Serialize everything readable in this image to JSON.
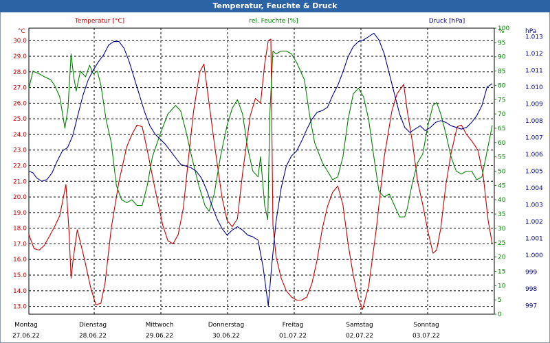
{
  "window": {
    "title": "Temperatur, Feuchte & Druck"
  },
  "colors": {
    "temperature": "#c00000",
    "humidity": "#008000",
    "pressure": "#00008b",
    "title_bg": "#2c63a5",
    "grid": "#000000"
  },
  "chart_data": {
    "type": "line",
    "title": "Temperatur, Feuchte & Druck",
    "grid": true,
    "axes": {
      "left": {
        "label": "Temperatur [°C]",
        "unit": "°C",
        "ylim": [
          12.5,
          30.8
        ],
        "ticks": [
          "13.0",
          "14.0",
          "15.0",
          "16.0",
          "17.0",
          "18.0",
          "19.0",
          "20.0",
          "21.0",
          "22.0",
          "23.0",
          "24.0",
          "25.0",
          "26.0",
          "27.0",
          "28.0",
          "29.0",
          "30.0"
        ]
      },
      "mid": {
        "label": "rel. Feuchte [%]",
        "unit": "%",
        "ylim": [
          0,
          100
        ],
        "ticks": [
          "0",
          "5",
          "10",
          "15",
          "20",
          "25",
          "30",
          "35",
          "40",
          "45",
          "50",
          "55",
          "60",
          "65",
          "70",
          "75",
          "80",
          "85",
          "90",
          "95",
          "100"
        ]
      },
      "right": {
        "label": "Druck [hPa]",
        "unit": "hPa",
        "ylim": [
          996.5,
          1013.5
        ],
        "ticks": [
          "997",
          "998",
          "999",
          "1.000",
          "1.001",
          "1.002",
          "1.003",
          "1.004",
          "1.005",
          "1.006",
          "1.007",
          "1.008",
          "1.009",
          "1.010",
          "1.011",
          "1.012",
          "1.013"
        ]
      }
    },
    "x_range": [
      0,
      7
    ],
    "days": [
      {
        "name": "Montag",
        "date": "27.06.22"
      },
      {
        "name": "Dienstag",
        "date": "28.06.22"
      },
      {
        "name": "Mittwoch",
        "date": "29.06.22"
      },
      {
        "name": "Donnerstag",
        "date": "30.06.22"
      },
      {
        "name": "Freitag",
        "date": "01.07.22"
      },
      {
        "name": "Samstag",
        "date": "02.07.22"
      },
      {
        "name": "Sonntag",
        "date": "03.07.22"
      }
    ],
    "series": [
      {
        "name": "Temperatur [°C]",
        "axis": "left",
        "color": "#c00000",
        "points": [
          [
            0,
            17.6
          ],
          [
            0.1,
            16.7
          ],
          [
            0.2,
            16.6
          ],
          [
            0.3,
            16.9
          ],
          [
            0.4,
            17.5
          ],
          [
            0.5,
            18.1
          ],
          [
            0.6,
            18.8
          ],
          [
            0.72,
            20.8
          ],
          [
            0.78,
            17.8
          ],
          [
            0.82,
            14.8
          ],
          [
            0.86,
            16.0
          ],
          [
            0.94,
            17.9
          ],
          [
            1.0,
            17.1
          ],
          [
            1.08,
            16.0
          ],
          [
            1.2,
            14.2
          ],
          [
            1.3,
            13.1
          ],
          [
            1.4,
            13.2
          ],
          [
            1.48,
            14.5
          ],
          [
            1.6,
            18.0
          ],
          [
            1.75,
            21.0
          ],
          [
            1.9,
            23.2
          ],
          [
            2.0,
            24.0
          ],
          [
            2.1,
            24.6
          ],
          [
            2.2,
            24.5
          ],
          [
            2.3,
            23.0
          ],
          [
            2.45,
            20.5
          ],
          [
            2.6,
            18.2
          ],
          [
            2.7,
            17.2
          ],
          [
            2.8,
            17.0
          ],
          [
            2.9,
            17.6
          ],
          [
            3.0,
            19.3
          ],
          [
            3.1,
            22.5
          ],
          [
            3.2,
            25.5
          ],
          [
            3.32,
            28.0
          ],
          [
            3.4,
            28.5
          ],
          [
            3.5,
            26.0
          ],
          [
            3.62,
            23.0
          ],
          [
            3.75,
            20.0
          ],
          [
            3.85,
            18.5
          ],
          [
            3.95,
            18.1
          ],
          [
            4.05,
            18.6
          ],
          [
            4.15,
            21.5
          ],
          [
            4.3,
            25.2
          ],
          [
            4.4,
            26.3
          ],
          [
            4.5,
            26.0
          ],
          [
            4.58,
            28.5
          ],
          [
            4.65,
            30.0
          ],
          [
            4.7,
            30.1
          ],
          [
            4.74,
            18.2
          ],
          [
            4.8,
            16.2
          ],
          [
            4.9,
            14.8
          ],
          [
            5.0,
            14.0
          ],
          [
            5.1,
            13.6
          ],
          [
            5.2,
            13.4
          ],
          [
            5.3,
            13.4
          ],
          [
            5.4,
            13.6
          ],
          [
            5.5,
            14.5
          ],
          [
            5.6,
            16.0
          ],
          [
            5.7,
            18.0
          ],
          [
            5.8,
            19.4
          ],
          [
            5.9,
            20.3
          ],
          [
            6.0,
            20.7
          ],
          [
            6.1,
            19.5
          ],
          [
            6.2,
            17.0
          ],
          [
            6.3,
            15.0
          ],
          [
            6.4,
            13.5
          ],
          [
            6.48,
            12.8
          ],
          [
            6.6,
            14.3
          ],
          [
            6.75,
            18.0
          ],
          [
            6.9,
            22.5
          ],
          [
            7.05,
            25.5
          ],
          [
            7.15,
            26.6
          ],
          [
            7.28,
            27.2
          ],
          [
            7.35,
            25.5
          ],
          [
            7.45,
            23.5
          ],
          [
            7.55,
            21.0
          ],
          [
            7.65,
            19.5
          ],
          [
            7.75,
            17.8
          ],
          [
            7.85,
            16.4
          ],
          [
            7.92,
            16.6
          ],
          [
            8.0,
            18.0
          ],
          [
            8.1,
            20.8
          ],
          [
            8.2,
            22.8
          ],
          [
            8.32,
            24.5
          ],
          [
            8.4,
            24.6
          ],
          [
            8.5,
            24.0
          ],
          [
            8.62,
            23.5
          ],
          [
            8.72,
            23.0
          ],
          [
            8.82,
            21.5
          ],
          [
            8.92,
            18.5
          ],
          [
            9.0,
            17.0
          ]
        ]
      },
      {
        "name": "rel. Feuchte [%]",
        "axis": "mid",
        "color": "#008000",
        "points": [
          [
            0,
            79
          ],
          [
            0.08,
            85
          ],
          [
            0.2,
            84
          ],
          [
            0.3,
            83
          ],
          [
            0.42,
            82
          ],
          [
            0.5,
            80
          ],
          [
            0.6,
            76
          ],
          [
            0.7,
            65
          ],
          [
            0.76,
            72
          ],
          [
            0.82,
            91
          ],
          [
            0.87,
            83
          ],
          [
            0.92,
            78
          ],
          [
            1.0,
            85
          ],
          [
            1.1,
            83
          ],
          [
            1.18,
            87
          ],
          [
            1.25,
            84
          ],
          [
            1.33,
            85
          ],
          [
            1.4,
            80
          ],
          [
            1.5,
            68
          ],
          [
            1.6,
            60
          ],
          [
            1.7,
            45
          ],
          [
            1.8,
            40
          ],
          [
            1.9,
            39
          ],
          [
            2.0,
            40
          ],
          [
            2.1,
            38
          ],
          [
            2.2,
            38
          ],
          [
            2.3,
            45
          ],
          [
            2.4,
            55
          ],
          [
            2.55,
            63
          ],
          [
            2.7,
            70
          ],
          [
            2.85,
            73
          ],
          [
            2.95,
            71
          ],
          [
            3.05,
            64
          ],
          [
            3.15,
            56
          ],
          [
            3.3,
            45
          ],
          [
            3.42,
            38
          ],
          [
            3.5,
            36
          ],
          [
            3.6,
            42
          ],
          [
            3.72,
            55
          ],
          [
            3.85,
            66
          ],
          [
            3.95,
            72
          ],
          [
            4.05,
            75
          ],
          [
            4.15,
            70
          ],
          [
            4.25,
            58
          ],
          [
            4.35,
            50
          ],
          [
            4.45,
            48
          ],
          [
            4.5,
            55
          ],
          [
            4.58,
            38
          ],
          [
            4.64,
            33
          ],
          [
            4.68,
            70
          ],
          [
            4.74,
            92
          ],
          [
            4.8,
            91
          ],
          [
            4.9,
            92
          ],
          [
            5.0,
            92
          ],
          [
            5.1,
            91
          ],
          [
            5.2,
            88
          ],
          [
            5.35,
            82
          ],
          [
            5.45,
            70
          ],
          [
            5.55,
            60
          ],
          [
            5.7,
            53
          ],
          [
            5.8,
            50
          ],
          [
            5.9,
            47
          ],
          [
            6.0,
            48
          ],
          [
            6.1,
            55
          ],
          [
            6.2,
            68
          ],
          [
            6.3,
            77
          ],
          [
            6.4,
            79
          ],
          [
            6.5,
            76
          ],
          [
            6.6,
            68
          ],
          [
            6.7,
            55
          ],
          [
            6.8,
            43
          ],
          [
            6.9,
            41
          ],
          [
            7.0,
            42
          ],
          [
            7.1,
            38
          ],
          [
            7.2,
            34
          ],
          [
            7.3,
            34
          ],
          [
            7.35,
            37
          ],
          [
            7.45,
            46
          ],
          [
            7.55,
            53
          ],
          [
            7.65,
            56
          ],
          [
            7.75,
            66
          ],
          [
            7.85,
            73
          ],
          [
            7.92,
            74
          ],
          [
            8.0,
            70
          ],
          [
            8.1,
            63
          ],
          [
            8.2,
            55
          ],
          [
            8.3,
            50
          ],
          [
            8.4,
            49
          ],
          [
            8.5,
            50
          ],
          [
            8.6,
            50
          ],
          [
            8.7,
            47
          ],
          [
            8.8,
            48
          ],
          [
            8.9,
            57
          ],
          [
            9.0,
            66
          ]
        ]
      },
      {
        "name": "Druck [hPa]",
        "axis": "right",
        "color": "#00008b",
        "points": [
          [
            0,
            1005.0
          ],
          [
            0.08,
            1004.9
          ],
          [
            0.15,
            1004.6
          ],
          [
            0.25,
            1004.4
          ],
          [
            0.35,
            1004.5
          ],
          [
            0.45,
            1004.9
          ],
          [
            0.55,
            1005.6
          ],
          [
            0.65,
            1006.2
          ],
          [
            0.75,
            1006.4
          ],
          [
            0.85,
            1007.1
          ],
          [
            0.95,
            1008.3
          ],
          [
            1.05,
            1009.5
          ],
          [
            1.15,
            1010.4
          ],
          [
            1.25,
            1011.0
          ],
          [
            1.35,
            1011.5
          ],
          [
            1.45,
            1011.9
          ],
          [
            1.55,
            1012.5
          ],
          [
            1.65,
            1012.7
          ],
          [
            1.75,
            1012.7
          ],
          [
            1.85,
            1012.3
          ],
          [
            1.95,
            1011.5
          ],
          [
            2.05,
            1010.5
          ],
          [
            2.15,
            1009.5
          ],
          [
            2.25,
            1008.5
          ],
          [
            2.35,
            1007.7
          ],
          [
            2.45,
            1007.2
          ],
          [
            2.55,
            1006.9
          ],
          [
            2.65,
            1006.6
          ],
          [
            2.75,
            1006.2
          ],
          [
            2.85,
            1005.8
          ],
          [
            2.95,
            1005.4
          ],
          [
            3.05,
            1005.3
          ],
          [
            3.15,
            1005.2
          ],
          [
            3.25,
            1005.0
          ],
          [
            3.35,
            1004.6
          ],
          [
            3.45,
            1003.9
          ],
          [
            3.55,
            1003.0
          ],
          [
            3.65,
            1002.2
          ],
          [
            3.75,
            1001.6
          ],
          [
            3.85,
            1001.2
          ],
          [
            3.95,
            1001.5
          ],
          [
            4.05,
            1001.7
          ],
          [
            4.15,
            1001.5
          ],
          [
            4.25,
            1001.2
          ],
          [
            4.35,
            1001.1
          ],
          [
            4.45,
            1000.9
          ],
          [
            4.55,
            999.3
          ],
          [
            4.65,
            997.0
          ],
          [
            4.72,
            999.5
          ],
          [
            4.8,
            1002.0
          ],
          [
            4.9,
            1004.0
          ],
          [
            5.0,
            1005.3
          ],
          [
            5.1,
            1005.9
          ],
          [
            5.2,
            1006.2
          ],
          [
            5.3,
            1006.8
          ],
          [
            5.4,
            1007.5
          ],
          [
            5.5,
            1008.1
          ],
          [
            5.6,
            1008.5
          ],
          [
            5.7,
            1008.6
          ],
          [
            5.8,
            1008.8
          ],
          [
            5.9,
            1009.5
          ],
          [
            6.0,
            1010.1
          ],
          [
            6.1,
            1010.9
          ],
          [
            6.2,
            1011.8
          ],
          [
            6.3,
            1012.4
          ],
          [
            6.4,
            1012.7
          ],
          [
            6.5,
            1012.8
          ],
          [
            6.6,
            1013.0
          ],
          [
            6.7,
            1013.2
          ],
          [
            6.8,
            1012.8
          ],
          [
            6.9,
            1012.0
          ],
          [
            7.0,
            1010.8
          ],
          [
            7.1,
            1009.6
          ],
          [
            7.2,
            1008.4
          ],
          [
            7.3,
            1007.6
          ],
          [
            7.4,
            1007.3
          ],
          [
            7.5,
            1007.5
          ],
          [
            7.6,
            1007.7
          ],
          [
            7.7,
            1007.4
          ],
          [
            7.8,
            1007.6
          ],
          [
            7.9,
            1007.9
          ],
          [
            8.0,
            1008.0
          ],
          [
            8.1,
            1007.9
          ],
          [
            8.2,
            1007.7
          ],
          [
            8.3,
            1007.6
          ],
          [
            8.4,
            1007.5
          ],
          [
            8.5,
            1007.6
          ],
          [
            8.6,
            1007.9
          ],
          [
            8.7,
            1008.3
          ],
          [
            8.8,
            1008.9
          ],
          [
            8.9,
            1010.0
          ],
          [
            9.0,
            1010.2
          ]
        ]
      }
    ]
  }
}
